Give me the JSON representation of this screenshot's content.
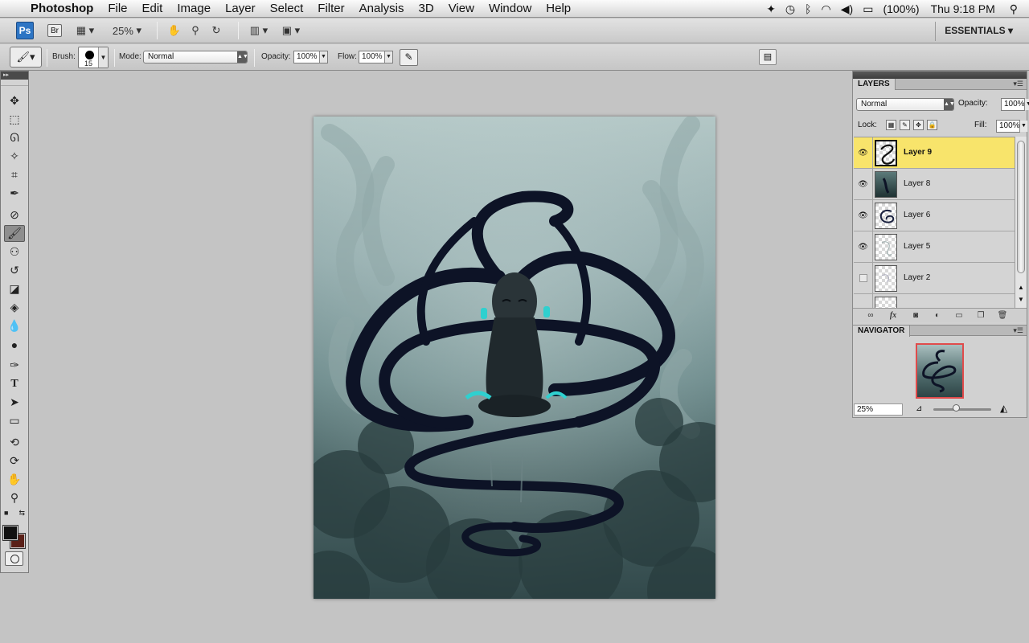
{
  "menubar": {
    "app_name": "Photoshop",
    "menus": [
      "File",
      "Edit",
      "Image",
      "Layer",
      "Select",
      "Filter",
      "Analysis",
      "3D",
      "View",
      "Window",
      "Help"
    ],
    "battery": "(100%)",
    "clock": "Thu 9:18 PM"
  },
  "appbar": {
    "ps_badge": "Ps",
    "br_badge": "Br",
    "zoom": "25%",
    "workspace": "ESSENTIALS"
  },
  "options": {
    "brush_label": "Brush:",
    "brush_size": "15",
    "mode_label": "Mode:",
    "mode_value": "Normal",
    "opacity_label": "Opacity:",
    "opacity_value": "100%",
    "flow_label": "Flow:",
    "flow_value": "100%"
  },
  "colors": {
    "foreground": "#111111",
    "background": "#5a2018",
    "selected_layer": "#f8e46b",
    "accent_teal": "#2fd0cf"
  },
  "layers_panel": {
    "tab": "LAYERS",
    "blend_mode": "Normal",
    "opacity_label": "Opacity:",
    "opacity_value": "100%",
    "lock_label": "Lock:",
    "fill_label": "Fill:",
    "fill_value": "100%",
    "layers": [
      {
        "name": "Layer 9",
        "visible": true,
        "selected": true
      },
      {
        "name": "Layer 8",
        "visible": true,
        "selected": false
      },
      {
        "name": "Layer 6",
        "visible": true,
        "selected": false
      },
      {
        "name": "Layer 5",
        "visible": true,
        "selected": false
      },
      {
        "name": "Layer 2",
        "visible": false,
        "selected": false
      }
    ]
  },
  "navigator": {
    "tab": "NAVIGATOR",
    "zoom": "25%"
  }
}
